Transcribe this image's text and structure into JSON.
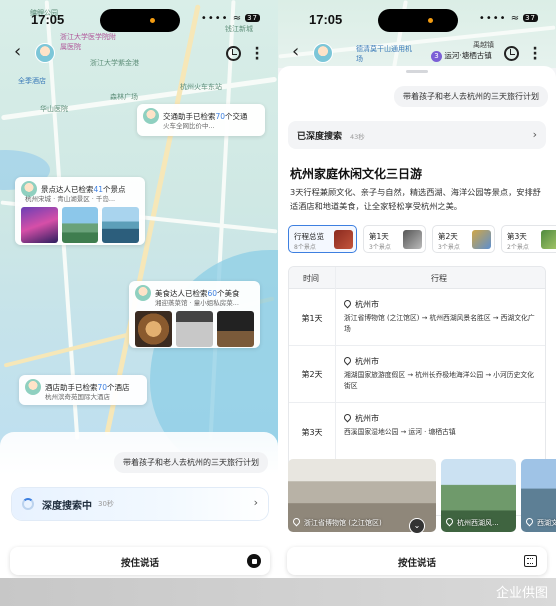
{
  "status_bar": {
    "time": "17:05",
    "signal_text": "•••• ≈",
    "battery_left": "37",
    "battery_right": "37"
  },
  "left": {
    "map_labels": [
      "鳙鲤公园",
      "浙江大学医学院附属医院",
      "全季酒店",
      "浙江大学紫金港",
      "华山医院",
      "森林广场",
      "杭州火车东站",
      "钱江新城"
    ],
    "agents": [
      {
        "title_pre": "交通助手已检索",
        "count": "70",
        "title_post": "个交通",
        "sub": "火车全网比价中..."
      },
      {
        "title_pre": "景点达人已检索",
        "count": "41",
        "title_post": "个景点",
        "sub": "杭州宋城 · 青山湖景区 · 千岛..."
      },
      {
        "title_pre": "美食达人已检索",
        "count": "60",
        "title_post": "个美食",
        "sub": "湘迎蒸菜馆 · 童小姐私房菜..."
      },
      {
        "title_pre": "酒店助手已检索",
        "count": "70",
        "title_post": "个酒店",
        "sub": "杭州滨奇苑国际大酒店"
      }
    ],
    "query": "带着孩子和老人去杭州的三天旅行计划",
    "deep_search": {
      "label": "深度搜索中",
      "seconds": "30秒"
    },
    "voice_label": "按住说话"
  },
  "right": {
    "header_labels": {
      "top": "德清莫干山通用机场",
      "right": "禹越镇"
    },
    "location_badge": {
      "num": "3",
      "text": "运河·塘栖古镇"
    },
    "query": "带着孩子和老人去杭州的三天旅行计划",
    "deep_search_done": {
      "label": "已深度搜索",
      "seconds": "43秒"
    },
    "plan": {
      "title": "杭州家庭休闲文化三日游",
      "description": "3天行程兼顾文化、亲子与自然，精选西湖、海洋公园等景点，安排舒适酒店和地道美食，让全家轻松享受杭州之美。",
      "tabs": [
        {
          "label": "行程总览",
          "sub": "8个景点"
        },
        {
          "label": "第1天",
          "sub": "3个景点"
        },
        {
          "label": "第2天",
          "sub": "3个景点"
        },
        {
          "label": "第3天",
          "sub": "2个景点"
        }
      ],
      "table": {
        "headers": [
          "时间",
          "行程"
        ],
        "rows": [
          {
            "day": "第1天",
            "city": "杭州市",
            "route": "浙江省博物馆 (之江馆区) → 杭州西湖风景名胜区 → 西湖文化广场"
          },
          {
            "day": "第2天",
            "city": "杭州市",
            "route": "湘湖国家旅游度假区 → 杭州长乔极地海洋公园 → 小河历史文化街区"
          },
          {
            "day": "第3天",
            "city": "杭州市",
            "route": "西溪国家湿地公园 → 运河 · 塘栖古镇"
          }
        ]
      },
      "gallery": [
        "浙江省博物馆 (之江馆区)",
        "杭州西湖风...",
        "西湖文"
      ]
    },
    "voice_label": "按住说话"
  },
  "watermark": "企业供图",
  "colors": {
    "accent": "#3d7fe0",
    "map_bg": "#d2eae5"
  }
}
